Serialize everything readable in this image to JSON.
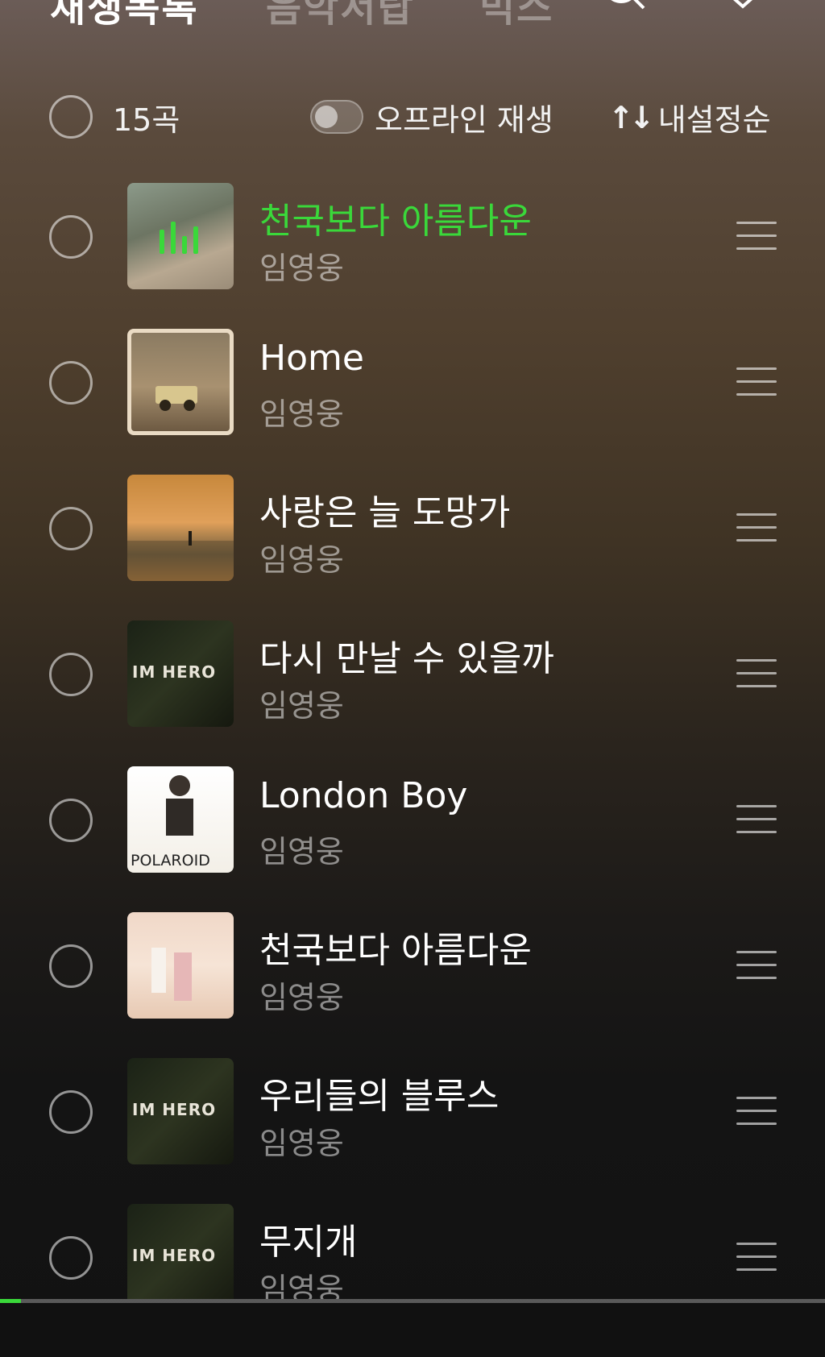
{
  "header": {
    "tabs": [
      {
        "label": "재생목록"
      },
      {
        "label": "음악서랍"
      },
      {
        "label": "믹스"
      }
    ]
  },
  "controls": {
    "count_label": "15곡",
    "offline_label": "오프라인 재생",
    "offline_enabled": false,
    "sort_icon": "sort-arrows-icon",
    "sort_label": "내설정순"
  },
  "tracks": [
    {
      "title": "천국보다 아름다운",
      "artist": "임영웅",
      "playing": true
    },
    {
      "title": "Home",
      "artist": "임영웅",
      "playing": false
    },
    {
      "title": "사랑은 늘 도망가",
      "artist": "임영웅",
      "playing": false
    },
    {
      "title": "다시 만날 수 있을까",
      "artist": "임영웅",
      "playing": false,
      "cover_text": "IM HERO"
    },
    {
      "title": "London Boy",
      "artist": "임영웅",
      "playing": false,
      "cover_text": "POLAROID"
    },
    {
      "title": "천국보다 아름다운",
      "artist": "임영웅",
      "playing": false
    },
    {
      "title": "우리들의 블루스",
      "artist": "임영웅",
      "playing": false,
      "cover_text": "IM HERO"
    },
    {
      "title": "무지개",
      "artist": "임영웅",
      "playing": false,
      "cover_text": "IM HERO"
    }
  ],
  "playback": {
    "progress_fraction": 0.025
  },
  "colors": {
    "accent": "#3ad83a"
  }
}
